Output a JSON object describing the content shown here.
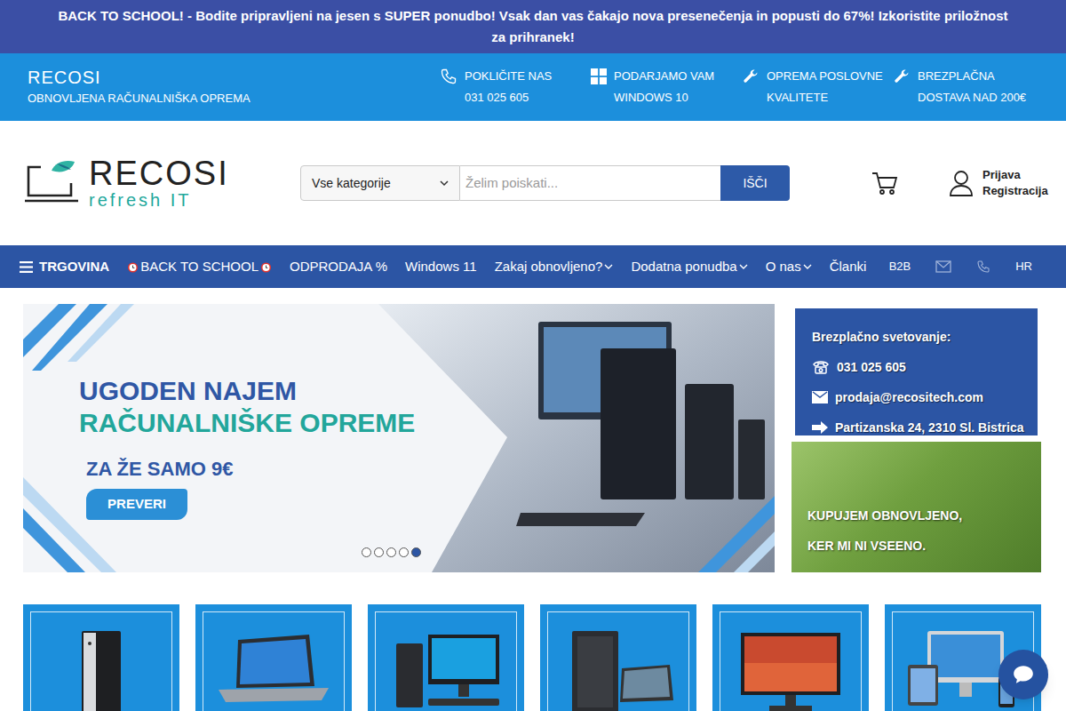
{
  "announcement": "BACK TO SCHOOL! - Bodite pripravljeni na jesen s SUPER ponudbo! Vsak dan vas čakajo nova presenečenja in popusti do 67%! Izkoristite priložnost za prihranek!",
  "topbar": {
    "brand": "RECOSI",
    "tagline": "OBNOVLJENA RAČUNALNIŠKA OPREMA",
    "features": [
      {
        "kind": "phone",
        "line1": "POKLIČITE NAS",
        "line2": "031 025 605"
      },
      {
        "kind": "windows",
        "line1": "PODARJAMO VAM",
        "line2": "WINDOWS 10"
      },
      {
        "kind": "wrench",
        "line1": "OPREMA POSLOVNE",
        "line2": "KVALITETE"
      },
      {
        "kind": "wrench",
        "line1": "BREZPLAČNA",
        "line2": "DOSTAVA NAD 200€"
      }
    ]
  },
  "header": {
    "logo": {
      "name": "RECOSI",
      "slogan": "refresh IT"
    },
    "search": {
      "category": "Vse kategorije",
      "placeholder": "Želim poiskati...",
      "button": "IŠČI"
    },
    "account": {
      "login": "Prijava",
      "register": "Registracija"
    }
  },
  "nav": {
    "items": [
      {
        "kind": "menu",
        "label": "TRGOVINA"
      },
      {
        "kind": "promo",
        "label": "BACK TO SCHOOL"
      },
      {
        "kind": "link",
        "label": "ODPRODAJA %"
      },
      {
        "kind": "link",
        "label": "Windows 11"
      },
      {
        "kind": "dropdown",
        "label": "Zakaj obnovljeno?"
      },
      {
        "kind": "dropdown",
        "label": "Dodatna ponudba"
      },
      {
        "kind": "dropdown",
        "label": "O nas"
      },
      {
        "kind": "link",
        "label": "Članki"
      },
      {
        "kind": "small",
        "label": "B2B"
      },
      {
        "kind": "mail"
      },
      {
        "kind": "phone"
      },
      {
        "kind": "small",
        "label": "HR"
      }
    ]
  },
  "slider": {
    "title1": "UGODEN NAJEM",
    "title2": "RAČUNALNIŠKE OPREME",
    "price": "ZA ŽE SAMO 9€",
    "button": "PREVERI",
    "dots": [
      {
        "selected": false
      },
      {
        "selected": false
      },
      {
        "selected": false
      },
      {
        "selected": false
      },
      {
        "selected": true
      }
    ]
  },
  "contact": {
    "title": "Brezplačno svetovanje:",
    "phone": "031 025 605",
    "email": "prodaja@recositech.com",
    "address": "Partizanska 24, 2310 Sl. Bistrica"
  },
  "promo": {
    "line1": "KUPUJEM OBNOVLJENO,",
    "line2": "KER MI NI VSEENO."
  },
  "categories": [
    {
      "kind": "tower"
    },
    {
      "kind": "laptop"
    },
    {
      "kind": "desktop"
    },
    {
      "kind": "workstation"
    },
    {
      "kind": "monitor"
    },
    {
      "kind": "apple"
    }
  ]
}
